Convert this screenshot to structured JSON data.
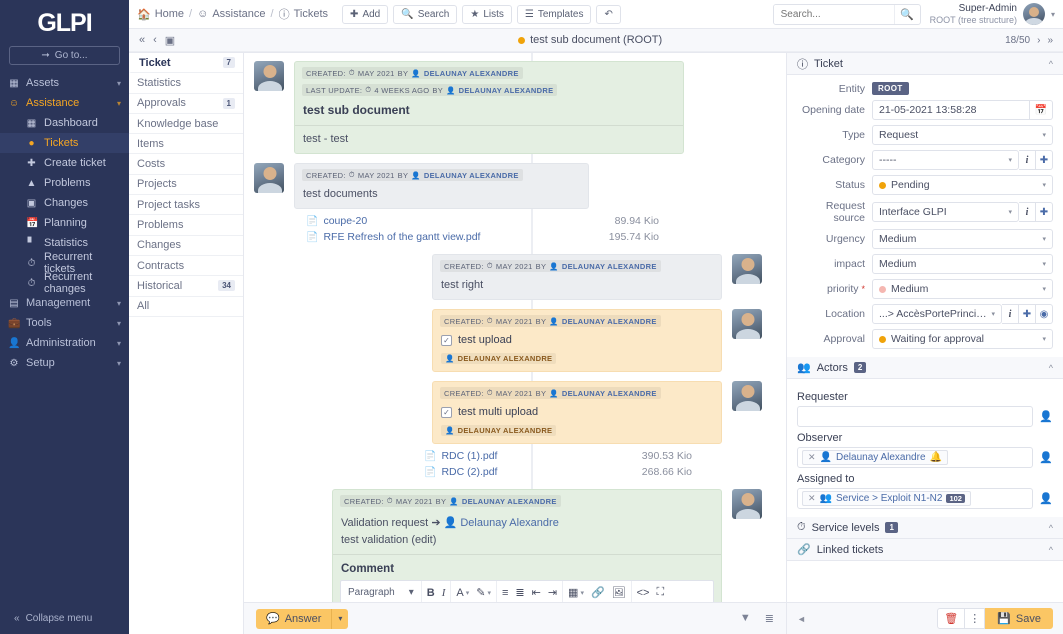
{
  "brand": {
    "name": "GLPI",
    "goto_label": "Go to...",
    "collapse_label": "Collapse menu"
  },
  "sidebar": {
    "groups": [
      {
        "label": "Assets",
        "icon": "assets-icon"
      },
      {
        "label": "Assistance",
        "icon": "assistance-icon",
        "active": true
      },
      {
        "label": "Management",
        "icon": "management-icon"
      },
      {
        "label": "Tools",
        "icon": "tools-icon"
      },
      {
        "label": "Administration",
        "icon": "administration-icon"
      },
      {
        "label": "Setup",
        "icon": "setup-icon"
      }
    ],
    "assistance_items": [
      {
        "label": "Dashboard",
        "icon": "dashboard-icon"
      },
      {
        "label": "Tickets",
        "icon": "ticket-icon",
        "selected": true
      },
      {
        "label": "Create ticket",
        "icon": "plus-icon"
      },
      {
        "label": "Problems",
        "icon": "warning-icon"
      },
      {
        "label": "Changes",
        "icon": "change-icon"
      },
      {
        "label": "Planning",
        "icon": "calendar-icon"
      },
      {
        "label": "Statistics",
        "icon": "chart-icon"
      },
      {
        "label": "Recurrent tickets",
        "icon": "recurrent-icon"
      },
      {
        "label": "Recurrent changes",
        "icon": "recurrent-icon"
      }
    ]
  },
  "topbar": {
    "breadcrumb": [
      {
        "label": "Home",
        "icon": "home-icon"
      },
      {
        "label": "Assistance",
        "icon": "assistance-icon"
      },
      {
        "label": "Tickets",
        "icon": "info-icon"
      }
    ],
    "buttons": [
      {
        "label": "Add",
        "icon": "plus-icon"
      },
      {
        "label": "Search",
        "icon": "search-icon"
      },
      {
        "label": "Lists",
        "icon": "star-icon"
      },
      {
        "label": "Templates",
        "icon": "layers-icon"
      }
    ],
    "history_icon": "history-icon",
    "search": {
      "placeholder": "Search...",
      "value": ""
    },
    "user": {
      "name": "Super-Admin",
      "entity": "ROOT (tree structure)"
    }
  },
  "titlebar": {
    "ticket_title": "test sub document (ROOT)",
    "status_color": "#f0a30a",
    "pager": "18/50"
  },
  "tabs": [
    {
      "label": "Ticket",
      "count": "7",
      "active": true
    },
    {
      "label": "Statistics",
      "count": ""
    },
    {
      "label": "Approvals",
      "count": "1"
    },
    {
      "label": "Knowledge base",
      "count": ""
    },
    {
      "label": "Items",
      "count": ""
    },
    {
      "label": "Costs",
      "count": ""
    },
    {
      "label": "Projects",
      "count": ""
    },
    {
      "label": "Project tasks",
      "count": ""
    },
    {
      "label": "Problems",
      "count": ""
    },
    {
      "label": "Changes",
      "count": ""
    },
    {
      "label": "Contracts",
      "count": ""
    },
    {
      "label": "Historical",
      "count": "34"
    },
    {
      "label": "All",
      "count": ""
    }
  ],
  "timeline": {
    "entry1": {
      "created_label": "CREATED:",
      "created_value": "MAY 2021",
      "by_label": "BY",
      "author": "DELAUNAY ALEXANDRE",
      "update_label": "LAST UPDATE:",
      "update_value": "4 WEEKS AGO",
      "update_by_label": "BY",
      "update_author": "DELAUNAY ALEXANDRE",
      "title": "test sub document",
      "body": "test - test"
    },
    "entry2": {
      "created_label": "CREATED:",
      "created_value": "MAY 2021",
      "by_label": "BY",
      "author": "DELAUNAY ALEXANDRE",
      "body": "test documents",
      "documents": [
        {
          "name": "coupe-20",
          "size": "89.94 Kio"
        },
        {
          "name": "RFE Refresh of the gantt view.pdf",
          "size": "195.74 Kio"
        }
      ]
    },
    "entry3": {
      "created_label": "CREATED:",
      "created_value": "MAY 2021",
      "by_label": "BY",
      "author": "DELAUNAY ALEXANDRE",
      "body": "test right"
    },
    "entry4": {
      "created_label": "CREATED:",
      "created_value": "MAY 2021",
      "by_label": "BY",
      "author": "DELAUNAY ALEXANDRE",
      "task": "test upload",
      "actor": "DELAUNAY ALEXANDRE"
    },
    "entry5": {
      "created_label": "CREATED:",
      "created_value": "MAY 2021",
      "by_label": "BY",
      "author": "DELAUNAY ALEXANDRE",
      "task": "test multi upload",
      "actor": "DELAUNAY ALEXANDRE",
      "documents": [
        {
          "name": "RDC (1).pdf",
          "size": "390.53 Kio"
        },
        {
          "name": "RDC (2).pdf",
          "size": "268.66 Kio"
        }
      ]
    },
    "entry6": {
      "created_label": "CREATED:",
      "created_value": "MAY 2021",
      "by_label": "BY",
      "author": "DELAUNAY ALEXANDRE",
      "validation_prefix": "Validation request",
      "validation_arrow": "➔",
      "validation_target": "Delaunay Alexandre",
      "validation_text": "test validation (edit)",
      "comment_label": "Comment"
    }
  },
  "editor": {
    "format": "Paragraph",
    "buttons": [
      {
        "name": "bold-icon",
        "glyph": "B"
      },
      {
        "name": "italic-icon",
        "glyph": "I"
      },
      {
        "name": "text-color-icon",
        "glyph": "A"
      },
      {
        "name": "highlight-icon",
        "glyph": "✎"
      },
      {
        "name": "bullet-list-icon",
        "glyph": "☰"
      },
      {
        "name": "numbered-list-icon",
        "glyph": "☰"
      },
      {
        "name": "outdent-icon",
        "glyph": "⇤"
      },
      {
        "name": "indent-icon",
        "glyph": "⇥"
      },
      {
        "name": "table-icon",
        "glyph": "▦"
      },
      {
        "name": "link-icon",
        "glyph": "🔗"
      },
      {
        "name": "image-icon",
        "glyph": "⛰"
      },
      {
        "name": "code-icon",
        "glyph": "<>"
      },
      {
        "name": "fullscreen-icon",
        "glyph": "⛶"
      }
    ]
  },
  "bottombar": {
    "answer_label": "Answer",
    "filter_icon": "filter-icon",
    "list_icon": "list-icon"
  },
  "rpanel": {
    "ticket_section": {
      "title": "Ticket",
      "fields": {
        "entity_label": "Entity",
        "entity_value": "ROOT",
        "opening_date_label": "Opening date",
        "opening_date_value": "21-05-2021 13:58:28",
        "type_label": "Type",
        "type_value": "Request",
        "category_label": "Category",
        "category_value": "-----",
        "status_label": "Status",
        "status_value": "Pending",
        "status_color": "#f0a30a",
        "request_source_label": "Request source",
        "request_source_value": "Interface GLPI",
        "urgency_label": "Urgency",
        "urgency_value": "Medium",
        "impact_label": "impact",
        "impact_value": "Medium",
        "priority_label": "priority",
        "priority_value": "Medium",
        "priority_color": "#f5b7b1",
        "location_label": "Location",
        "location_value": "...> AccèsPortePrincipale",
        "approval_label": "Approval",
        "approval_value": "Waiting for approval",
        "approval_color": "#f0a30a"
      }
    },
    "actors_section": {
      "title": "Actors",
      "count": "2",
      "requester_label": "Requester",
      "requester_value": "",
      "observer_label": "Observer",
      "observer_chip": "Delaunay Alexandre",
      "assigned_label": "Assigned to",
      "assigned_chip": "Service > Exploit N1-N2",
      "assigned_badge": "102"
    },
    "service_levels": {
      "title": "Service levels",
      "count": "1"
    },
    "linked_tickets": {
      "title": "Linked tickets"
    },
    "footer": {
      "save_label": "Save",
      "delete_icon": "trash-icon",
      "more_icon": "more-vertical-icon"
    }
  }
}
